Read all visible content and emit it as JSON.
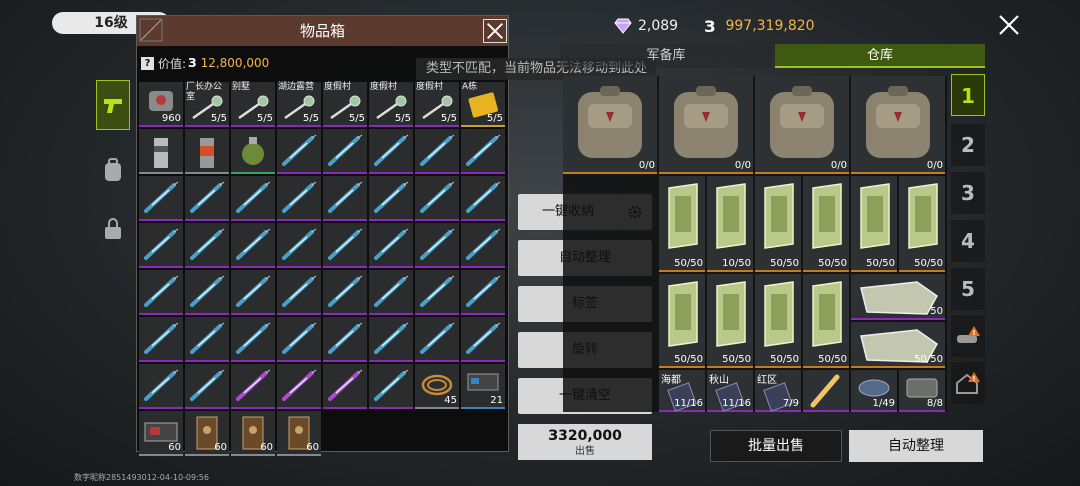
{
  "top": {
    "level": "16级",
    "gems": "2,089",
    "coin_symbol": "З",
    "coins": "997,319,820"
  },
  "box": {
    "title": "物品箱",
    "value_label": "价值:",
    "value_coin": "З",
    "value_amount": "12,800,000",
    "help": "?",
    "slots": [
      {
        "name": "",
        "qty": "960",
        "type": "charm"
      },
      {
        "name": "厂长办公室",
        "qty": "5/5",
        "type": "key"
      },
      {
        "name": "别墅",
        "qty": "5/5",
        "type": "key"
      },
      {
        "name": "湖边露营",
        "qty": "5/5",
        "type": "key"
      },
      {
        "name": "度假村",
        "qty": "5/5",
        "type": "key"
      },
      {
        "name": "度假村",
        "qty": "5/5",
        "type": "key"
      },
      {
        "name": "度假村",
        "qty": "5/5",
        "type": "key"
      },
      {
        "name": "A栋",
        "qty": "5/5",
        "type": "card"
      }
    ],
    "bottom_items": [
      {
        "qty": "45"
      },
      {
        "qty": "21"
      },
      {
        "qty": "60"
      },
      {
        "qty": "60"
      },
      {
        "qty": "60"
      },
      {
        "qty": "60"
      }
    ]
  },
  "toast": "类型不匹配，当前物品无法移动到此处",
  "actions": {
    "collect": "一键收纳",
    "auto_sort": "自动整理",
    "tag": "标签",
    "rotate": "旋转",
    "clear": "一键清空",
    "sell_coin": "З",
    "sell_total": "320,000",
    "sell_label": "出售"
  },
  "tabs": {
    "armory": "军备库",
    "warehouse": "仓库"
  },
  "warehouse": {
    "backpacks": [
      "0/0",
      "0/0",
      "0/0",
      "0/0"
    ],
    "row2": [
      "50/50",
      "10/50",
      "50/50",
      "50/50",
      "50/50",
      "50/50"
    ],
    "row3": [
      "50/50",
      "50/50",
      "50/50",
      "50/50"
    ],
    "row3_right": "50",
    "row4": [
      "50/50",
      "50/50",
      "50/50",
      "50/50"
    ],
    "row4_right": "50/50",
    "keys": [
      {
        "name": "海都",
        "qty": "11/16"
      },
      {
        "name": "秋山",
        "qty": "11/16"
      },
      {
        "name": "红区",
        "qty": "7/9"
      }
    ],
    "misc": [
      "1/49",
      "8/8"
    ]
  },
  "pages": [
    "1",
    "2",
    "3",
    "4",
    "5"
  ],
  "bottom": {
    "bulk_sell": "批量出售",
    "auto_sort": "自动整理"
  },
  "watermark": "数字昵称2851493012-04-10-09:56",
  "colors": {
    "accent": "#9bc51c",
    "gold": "#f3b54a",
    "purple": "#8a2ab8",
    "box_header": "#5c3b2e"
  }
}
